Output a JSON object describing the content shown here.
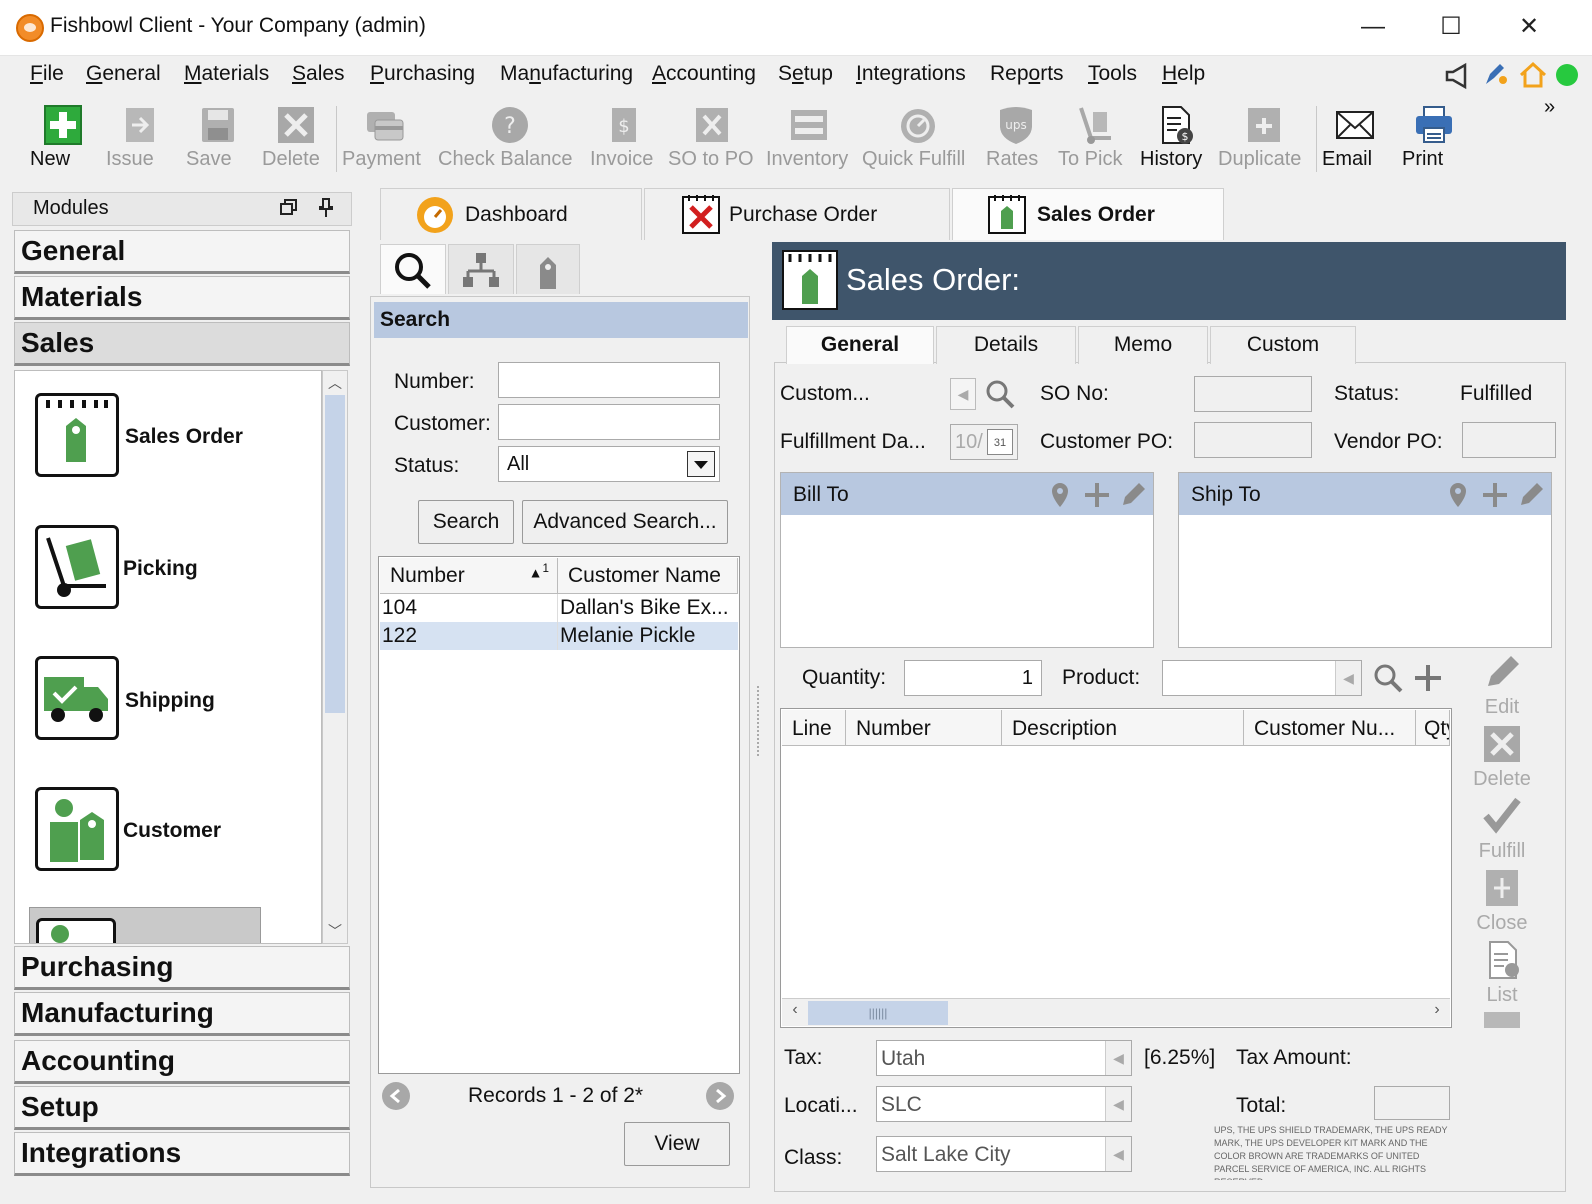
{
  "window": {
    "title": "Fishbowl Client - Your Company (admin)",
    "minimize": "—",
    "maximize": "☐",
    "close": "✕"
  },
  "menu": [
    {
      "pre": "",
      "key": "F",
      "post": "ile"
    },
    {
      "pre": "",
      "key": "G",
      "post": "eneral"
    },
    {
      "pre": "",
      "key": "M",
      "post": "aterials"
    },
    {
      "pre": "",
      "key": "S",
      "post": "ales"
    },
    {
      "pre": "",
      "key": "P",
      "post": "urchasing"
    },
    {
      "pre": "Ma",
      "key": "n",
      "post": "ufacturing"
    },
    {
      "pre": "",
      "key": "A",
      "post": "ccounting"
    },
    {
      "pre": "S",
      "key": "e",
      "post": "tup"
    },
    {
      "pre": "",
      "key": "I",
      "post": "ntegrations"
    },
    {
      "pre": "Rep",
      "key": "o",
      "post": "rts"
    },
    {
      "pre": "",
      "key": "T",
      "post": "ools"
    },
    {
      "pre": "",
      "key": "H",
      "post": "elp"
    }
  ],
  "toolbar": {
    "new": "New",
    "issue": "Issue",
    "save": "Save",
    "delete": "Delete",
    "payment": "Payment",
    "check_balance": "Check Balance",
    "invoice": "Invoice",
    "so_to_po": "SO to PO",
    "inventory": "Inventory",
    "quick_fulfill": "Quick Fulfill",
    "rates": "Rates",
    "to_pick": "To Pick",
    "history": "History",
    "duplicate": "Duplicate",
    "email": "Email",
    "print": "Print",
    "more": "»"
  },
  "modules": {
    "title": "Modules",
    "groups": [
      "General",
      "Materials",
      "Sales",
      "Purchasing",
      "Manufacturing",
      "Accounting",
      "Setup",
      "Integrations"
    ],
    "sales_items": [
      "Sales Order",
      "Picking",
      "Shipping",
      "Customer"
    ]
  },
  "tabs": [
    "Dashboard",
    "Purchase Order",
    "Sales Order"
  ],
  "search": {
    "header": "Search",
    "number_label": "Number:",
    "number_value": "",
    "customer_label": "Customer:",
    "customer_value": "",
    "status_label": "Status:",
    "status_value": "All",
    "search_button": "Search",
    "advanced_button": "Advanced Search...",
    "columns": [
      "Number",
      "Customer Name"
    ],
    "sort_indicator": "1",
    "rows": [
      {
        "number": "104",
        "customer": "Dallan's Bike Ex..."
      },
      {
        "number": "122",
        "customer": "Melanie Pickle"
      }
    ],
    "records": "Records 1 - 2 of 2*",
    "view_button": "View"
  },
  "sales_order": {
    "title": "Sales Order:",
    "tabs": [
      "General",
      "Details",
      "Memo",
      "Custom"
    ],
    "custom_label": "Custom...",
    "so_no_label": "SO No:",
    "status_label": "Status:",
    "status_value": "Fulfilled",
    "fulfillment_label": "Fulfillment Da...",
    "fulfillment_value": "10/",
    "calendar_day": "31",
    "customer_po_label": "Customer PO:",
    "vendor_po_label": "Vendor PO:",
    "bill_to": "Bill To",
    "ship_to": "Ship To",
    "quantity_label": "Quantity:",
    "quantity_value": "1",
    "product_label": "Product:",
    "item_columns": [
      "Line",
      "Number",
      "Description",
      "Customer Nu...",
      "Qty"
    ],
    "actions": [
      "Edit",
      "Delete",
      "Fulfill",
      "Close",
      "List"
    ],
    "tax_label": "Tax:",
    "tax_value": "Utah",
    "tax_rate": "[6.25%]",
    "tax_amount_label": "Tax Amount:",
    "location_label": "Locati...",
    "location_value": "SLC",
    "total_label": "Total:",
    "class_label": "Class:",
    "class_value": "Salt Lake City",
    "ups_notice": "UPS, THE UPS SHIELD TRADEMARK, THE UPS READY MARK, THE UPS DEVELOPER KIT MARK AND THE COLOR BROWN ARE TRADEMARKS OF UNITED PARCEL SERVICE OF AMERICA, INC. ALL RIGHTS RESERVED."
  },
  "colors": {
    "accent_green": "#2eaa3c",
    "header_blue": "#b8c8e0",
    "so_header": "#3f556b",
    "status_green": "#27c93f"
  }
}
